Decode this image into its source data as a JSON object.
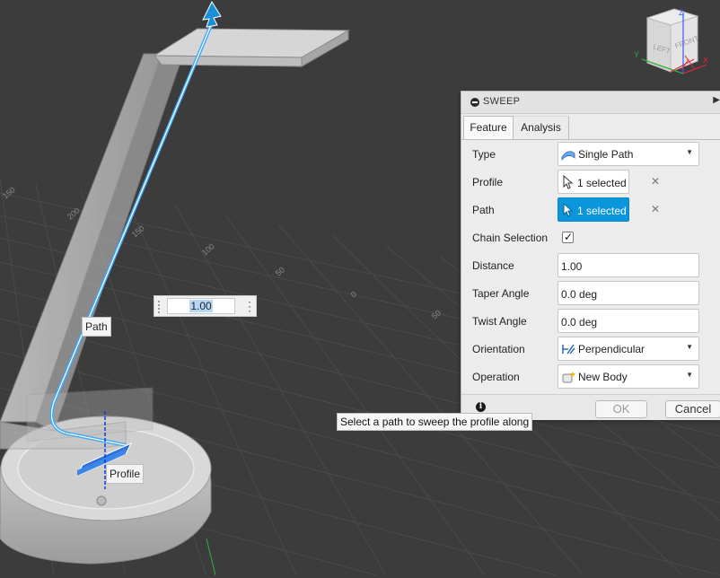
{
  "canvas": {
    "path_label": "Path",
    "profile_label": "Profile",
    "distance_value": "1.00",
    "grid_labels": [
      "150",
      "200",
      "150",
      "100",
      "50",
      "0",
      "50"
    ],
    "view_cube": {
      "left": "LEFT",
      "front": "FRONT",
      "axis_x": "X",
      "axis_y": "Y",
      "axis_z": "Z"
    }
  },
  "dialog": {
    "title": "SWEEP",
    "tabs": [
      "Feature",
      "Analysis"
    ],
    "rows": {
      "type": {
        "label": "Type",
        "value": "Single Path",
        "icon": "sweep-single-path-icon"
      },
      "profile": {
        "label": "Profile",
        "value": "1 selected"
      },
      "path": {
        "label": "Path",
        "value": "1 selected"
      },
      "chain_selection": {
        "label": "Chain Selection",
        "checked": true
      },
      "distance": {
        "label": "Distance",
        "value": "1.00"
      },
      "taper_angle": {
        "label": "Taper Angle",
        "value": "0.0 deg"
      },
      "twist_angle": {
        "label": "Twist Angle",
        "value": "0.0 deg"
      },
      "orientation": {
        "label": "Orientation",
        "value": "Perpendicular",
        "icon": "perpendicular-icon"
      },
      "operation": {
        "label": "Operation",
        "value": "New Body",
        "icon": "new-body-icon"
      }
    },
    "ok_label": "OK",
    "cancel_label": "Cancel",
    "tooltip": "Select a path to sweep the profile along"
  },
  "colors": {
    "background": "#3c3c3c",
    "accent": "#0a96dc",
    "path_highlight": "#3fa9f5"
  }
}
